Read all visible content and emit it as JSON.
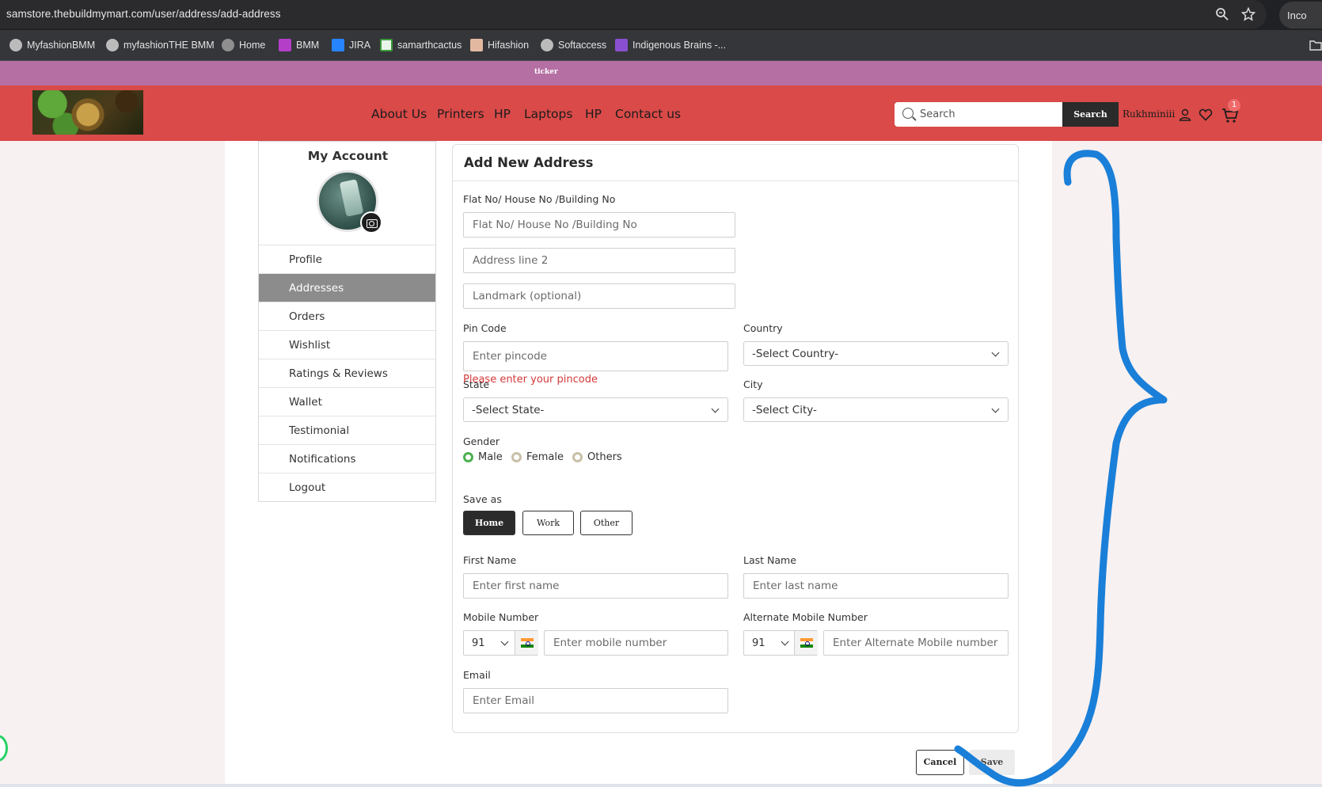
{
  "browser": {
    "url": "samstore.thebuildmymart.com/user/address/add-address",
    "profile_label": "Inco",
    "bookmarks": [
      {
        "label": "MyfashionBMM",
        "color": "#bbbbbb"
      },
      {
        "label": "myfashionTHE BMM",
        "color": "#bbbbbb"
      },
      {
        "label": "Home",
        "color": "#8f8f8f"
      },
      {
        "label": "BMM",
        "color": "#b43ec7"
      },
      {
        "label": "JIRA",
        "color": "#2684ff"
      },
      {
        "label": "samarthcactus",
        "color": "#e9f5e9"
      },
      {
        "label": "Hifashion",
        "color": "#e2b9a0"
      },
      {
        "label": "Softaccess",
        "color": "#bbbbbb"
      },
      {
        "label": "Indigenous Brains -...",
        "color": "#8a4fd1"
      }
    ]
  },
  "ticker": {
    "text": "ticker"
  },
  "header": {
    "nav": [
      "About Us",
      "Printers",
      "HP",
      "Laptops",
      "HP",
      "Contact us"
    ],
    "search_placeholder": "Search",
    "search_button": "Search",
    "username": "Rukhminiii",
    "cart_count": "1"
  },
  "sidebar": {
    "title": "My Account",
    "items": [
      "Profile",
      "Addresses",
      "Orders",
      "Wishlist",
      "Ratings & Reviews",
      "Wallet",
      "Testimonial",
      "Notifications",
      "Logout"
    ],
    "active": "Addresses"
  },
  "form": {
    "title": "Add New Address",
    "flat_label": "Flat No/ House No /Building No",
    "flat_placeholder": "Flat No/ House No /Building No",
    "address2_placeholder": "Address line 2",
    "landmark_placeholder": "Landmark (optional)",
    "pincode_label": "Pin Code",
    "pincode_placeholder": "Enter pincode",
    "pincode_error": "Please enter your pincode",
    "country_label": "Country",
    "country_value": "-Select Country-",
    "state_label": "State",
    "state_value": "-Select State-",
    "city_label": "City",
    "city_value": "-Select City-",
    "gender_label": "Gender",
    "gender_options": [
      "Male",
      "Female",
      "Others"
    ],
    "gender_selected": "Male",
    "save_as_label": "Save as",
    "save_as_options": [
      "Home",
      "Work",
      "Other"
    ],
    "save_as_selected": "Home",
    "first_name_label": "First Name",
    "first_name_placeholder": "Enter first name",
    "last_name_label": "Last Name",
    "last_name_placeholder": "Enter last name",
    "mobile_label": "Mobile Number",
    "mobile_code": "91",
    "mobile_placeholder": "Enter mobile number",
    "alt_mobile_label": "Alternate Mobile Number",
    "alt_mobile_code": "91",
    "alt_mobile_placeholder": "Enter Alternate Mobile number",
    "email_label": "Email",
    "email_placeholder": "Enter Email",
    "cancel": "Cancel",
    "save": "Save"
  },
  "colors": {
    "header": "#d94a48",
    "ticker": "#b56fa3",
    "annotation": "#1a7fd8",
    "error": "#d43a3a"
  }
}
